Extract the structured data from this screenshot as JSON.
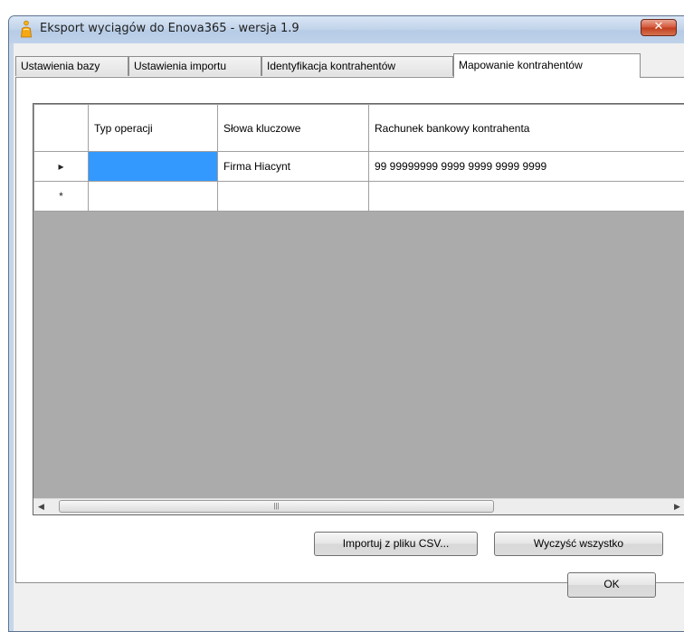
{
  "window": {
    "title": "Eksport wyciągów do Enova365 - wersja 1.9",
    "close_label": "✕"
  },
  "tabs": [
    {
      "label": "Ustawienia bazy"
    },
    {
      "label": "Ustawienia importu"
    },
    {
      "label": "Identyfikacja kontrahentów"
    },
    {
      "label": "Mapowanie kontrahentów"
    }
  ],
  "grid": {
    "columns": [
      {
        "header": ""
      },
      {
        "header": "Typ operacji"
      },
      {
        "header": "Słowa kluczowe"
      },
      {
        "header": "Rachunek bankowy kontrahenta"
      }
    ],
    "rows": [
      {
        "marker": "▸",
        "typ_operacji": "",
        "slowa_kluczowe": "Firma Hiacynt",
        "rachunek": "99 99999999 9999 9999 9999 9999"
      },
      {
        "marker": "*",
        "typ_operacji": "",
        "slowa_kluczowe": "",
        "rachunek": ""
      }
    ],
    "scroll_left": "◀",
    "scroll_right": "▶",
    "scroll_grip": "|||"
  },
  "buttons": {
    "import_csv": "Importuj z pliku CSV...",
    "clear_all": "Wyczyść wszystko",
    "ok": "OK"
  },
  "colors": {
    "selected_cell": "#3399ff",
    "grid_background": "#ababab",
    "close_button": "#c94a2c"
  }
}
